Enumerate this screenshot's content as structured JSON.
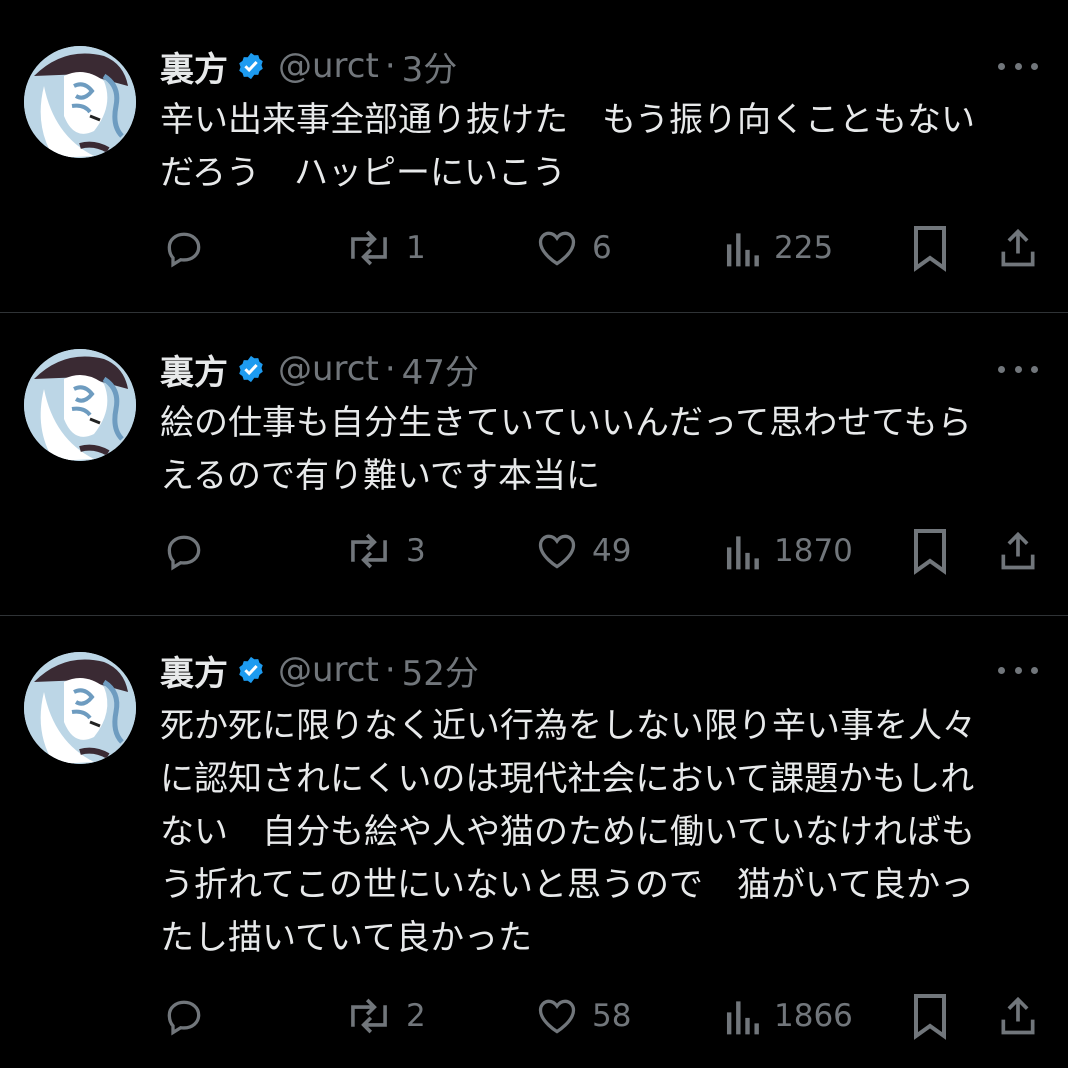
{
  "tweets": [
    {
      "name": "裏方",
      "handle": "@urct",
      "time": "3分",
      "lines": [
        "辛い出来事全部通り抜けた　もう振り向くこともない",
        "だろう　ハッピーにいこう"
      ],
      "retweets": "1",
      "likes": "6",
      "views": "225"
    },
    {
      "name": "裏方",
      "handle": "@urct",
      "time": "47分",
      "lines": [
        "絵の仕事も自分生きていていいんだって思わせてもら",
        "えるので有り難いです本当に"
      ],
      "retweets": "3",
      "likes": "49",
      "views": "1870"
    },
    {
      "name": "裏方",
      "handle": "@urct",
      "time": "52分",
      "lines": [
        "死か死に限りなく近い行為をしない限り辛い事を人々",
        "に認知されにくいのは現代社会において課題かもしれ",
        "ない　自分も絵や人や猫のために働いていなければも",
        "う折れてこの世にいないと思うので　猫がいて良かっ",
        "たし描いていて良かった"
      ],
      "retweets": "2",
      "likes": "58",
      "views": "1866"
    }
  ],
  "colors": {
    "background": "#000000",
    "text": "#e7e9ea",
    "muted": "#71767b",
    "verified": "#1d9bf0",
    "divider": "#2f3336"
  },
  "icons": [
    "reply-icon",
    "retweet-icon",
    "like-icon",
    "views-icon",
    "bookmark-icon",
    "share-icon",
    "more-icon",
    "verified-badge-icon"
  ]
}
